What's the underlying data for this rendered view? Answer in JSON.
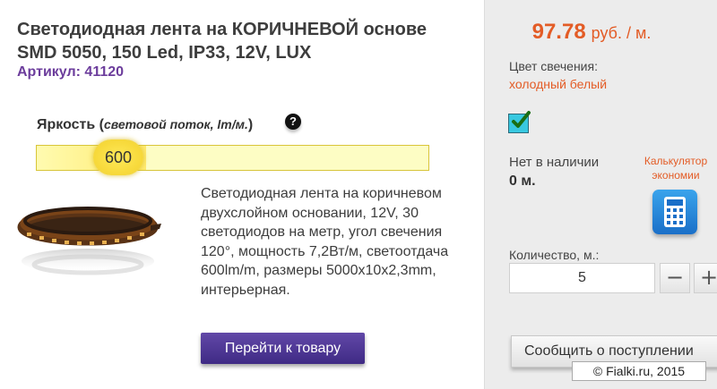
{
  "product": {
    "title": "Светодиодная лента на КОРИЧНЕВОЙ основе SMD 5050, 150 Led, IP33, 12V, LUX",
    "sku": "Артикул: 41120",
    "brightness_label_prefix": "Яркость (",
    "brightness_label_italic": "световой поток, lm/м.",
    "brightness_label_suffix": ")",
    "brightness_value": "600",
    "description": "Светодиодная лента на коричневом двухслойном основании, 12V, 30 светодиодов на метр, угол свечения 120°, мощность 7,2Вт/м, светоотдача 600lm/m, размеры 5000x10x2,3mm, интерьерная.",
    "go_button": "Перейти к товару"
  },
  "sidebar": {
    "price_value": "97.78",
    "price_unit": "руб. / м.",
    "color_label": "Цвет свечения:",
    "color_value": "холодный белый",
    "stock_label": "Нет в наличии",
    "stock_value": "0 м.",
    "calc_label": "Калькулятор экономии",
    "qty_label": "Количество, м.:",
    "qty_value": "5",
    "minus": "−",
    "plus": "+",
    "notify_button": "Сообщить о поступлении"
  },
  "watermark": "© Fialki.ru, 2015",
  "colors": {
    "accent": "#e35c26",
    "sku": "#6c3d9c",
    "button": "#4f3896",
    "slider": "#ffe95a"
  },
  "icons": [
    "question-icon",
    "checkbox-icon",
    "calculator-icon",
    "led-strip-image"
  ]
}
